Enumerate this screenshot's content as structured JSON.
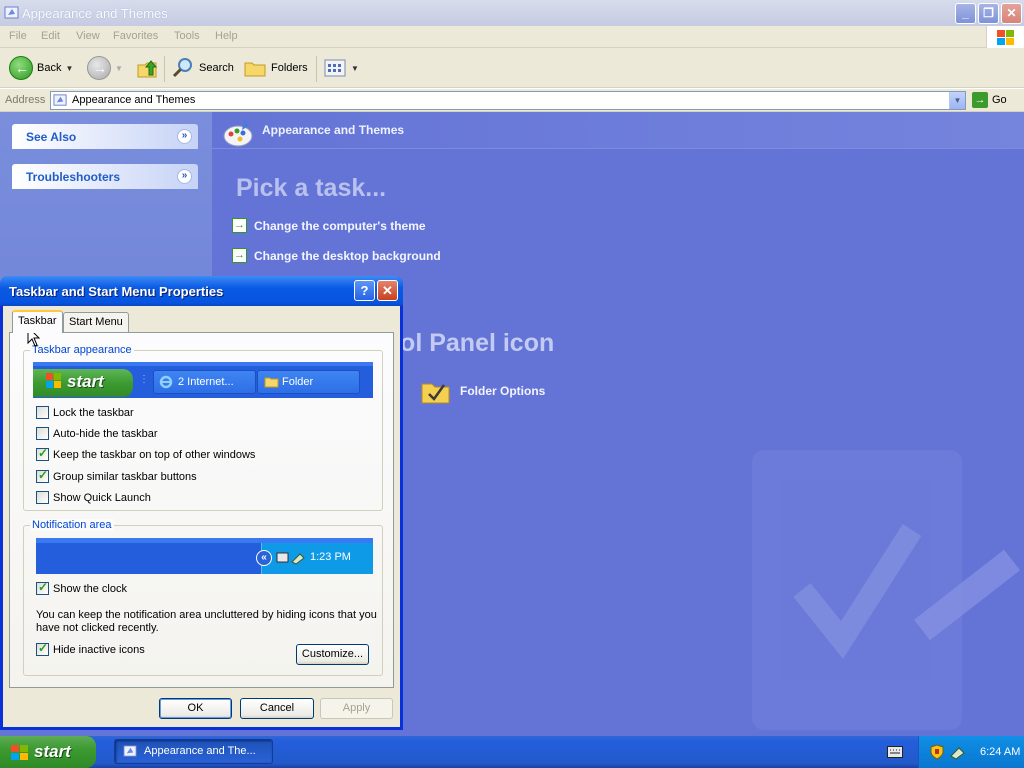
{
  "window": {
    "title": "Appearance and Themes",
    "minimize_icon": "minimize-icon",
    "maximize_icon": "restore-icon",
    "close_icon": "close-icon"
  },
  "menu": [
    "File",
    "Edit",
    "View",
    "Favorites",
    "Tools",
    "Help"
  ],
  "toolbar": {
    "back_label": "Back",
    "search_label": "Search",
    "folders_label": "Folders"
  },
  "address": {
    "label": "Address",
    "value": "Appearance and Themes",
    "go_label": "Go"
  },
  "sidebar": {
    "panels": [
      {
        "label": "See Also"
      },
      {
        "label": "Troubleshooters"
      }
    ]
  },
  "content": {
    "header": "Appearance and Themes",
    "pick_heading": "Pick a task...",
    "tasks": [
      "Change the computer's theme",
      "Change the desktop background"
    ],
    "cp_heading": "trol Panel icon",
    "cp_items": [
      "Folder Options"
    ]
  },
  "dialog": {
    "title": "Taskbar and Start Menu Properties",
    "tabs": [
      "Taskbar",
      "Start Menu"
    ],
    "appearance_group": "Taskbar appearance",
    "preview": {
      "start_label": "start",
      "ie_button": "2 Internet...",
      "folder_button": "Folder"
    },
    "options": [
      {
        "label": "Lock the taskbar",
        "checked": false
      },
      {
        "label": "Auto-hide the taskbar",
        "checked": false
      },
      {
        "label": "Keep the taskbar on top of other windows",
        "checked": true
      },
      {
        "label": "Group similar taskbar buttons",
        "checked": true
      },
      {
        "label": "Show Quick Launch",
        "checked": false
      }
    ],
    "notification_group": "Notification area",
    "notif_time": "1:23 PM",
    "show_clock": {
      "label": "Show the clock",
      "checked": true
    },
    "note": "You can keep the notification area uncluttered by hiding icons that you have not clicked recently.",
    "hide_inactive": {
      "label": "Hide inactive icons",
      "checked": true
    },
    "customize_label": "Customize...",
    "ok_label": "OK",
    "cancel_label": "Cancel",
    "apply_label": "Apply"
  },
  "taskbar": {
    "start_label": "start",
    "window_button": "Appearance and The...",
    "clock": "6:24 AM"
  },
  "colors": {
    "content_bg": "#6474d6",
    "dialog_title": "#0654e0",
    "taskbar": "#245edc",
    "start_green": "#3c9b31"
  }
}
